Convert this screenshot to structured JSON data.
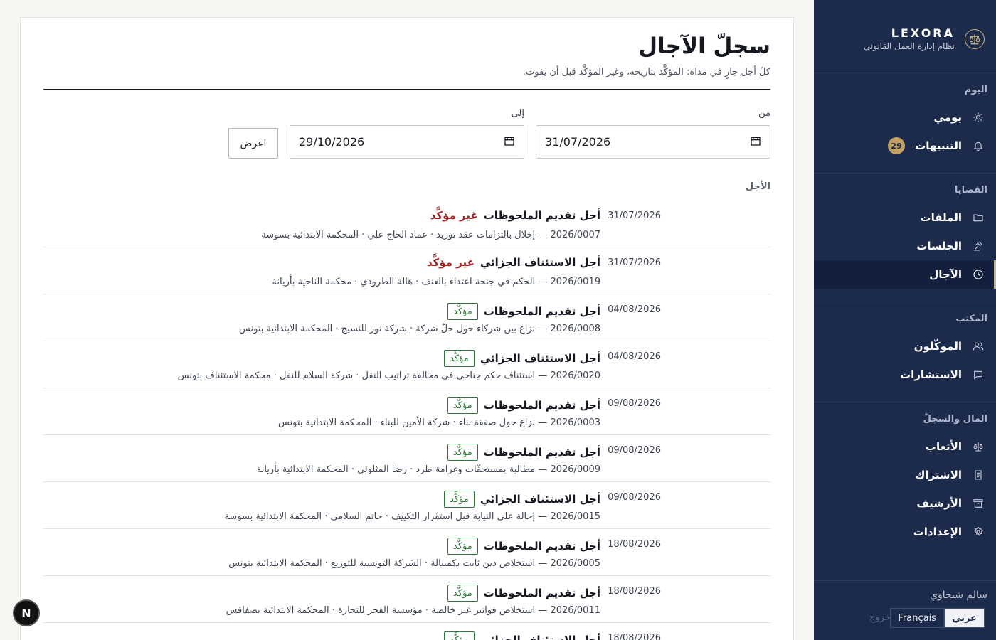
{
  "brand": {
    "name": "LEXORA",
    "subtitle": "نظام إدارة العمل القانوني"
  },
  "nav": [
    {
      "heading": "اليوم",
      "items": [
        {
          "label": "يومي",
          "icon": "sun-icon"
        },
        {
          "label": "التنبيهات",
          "icon": "bell-icon",
          "badge": "29"
        }
      ]
    },
    {
      "heading": "القضايا",
      "items": [
        {
          "label": "الملفات",
          "icon": "folder-icon"
        },
        {
          "label": "الجلسات",
          "icon": "gavel-icon"
        },
        {
          "label": "الآجال",
          "icon": "clock-icon",
          "active": true
        }
      ]
    },
    {
      "heading": "المكتب",
      "items": [
        {
          "label": "الموكّلون",
          "icon": "users-icon"
        },
        {
          "label": "الاستشارات",
          "icon": "chat-icon"
        }
      ]
    },
    {
      "heading": "المال والسجلّ",
      "items": [
        {
          "label": "الأتعاب",
          "icon": "scale-icon"
        },
        {
          "label": "الاشتراك",
          "icon": "receipt-icon"
        },
        {
          "label": "الأرشيف",
          "icon": "archive-icon"
        },
        {
          "label": "الإعدادات",
          "icon": "gear-icon"
        }
      ]
    }
  ],
  "user": {
    "name": "سالم شيحاوي",
    "lang_ar": "عربي",
    "lang_fr": "Français",
    "logout": "خروج"
  },
  "page": {
    "title": "سجلّ الآجال",
    "subtitle": "كلّ أجل جارٍ في مداه: المؤكَّد بتاريخه، وغير المؤكَّد قبل أن يفوت.",
    "from_label": "من",
    "to_label": "إلى",
    "from_value": "31/07/2026",
    "to_value": "29/10/2026",
    "show_button": "اعرض",
    "column_header": "الأجل"
  },
  "status_labels": {
    "confirmed": "مؤكَّد",
    "unconfirmed": "غير مؤكَّد"
  },
  "deadlines": [
    {
      "date": "31/07/2026",
      "title": "أجل تقديم الملحوظات",
      "status": "unconfirmed",
      "meta": "2026/0007 — إخلال بالتزامات عقد توريد · عماد الحاج علي · المحكمة الابتدائية بسوسة"
    },
    {
      "date": "31/07/2026",
      "title": "أجل الاستئناف الجزائي",
      "status": "unconfirmed",
      "meta": "2026/0019 — الحكم في جنحة اعتداء بالعنف · هالة الطرودي · محكمة الناحية بأريانة"
    },
    {
      "date": "04/08/2026",
      "title": "أجل تقديم الملحوظات",
      "status": "confirmed",
      "meta": "2026/0008 — نزاع بين شركاء حول حلّ شركة · شركة نور للنسيج · المحكمة الابتدائية بتونس"
    },
    {
      "date": "04/08/2026",
      "title": "أجل الاستئناف الجزائي",
      "status": "confirmed",
      "meta": "2026/0020 — استئناف حكم جناحي في مخالفة تراتيب النقل · شركة السلام للنقل · محكمة الاستئناف بتونس"
    },
    {
      "date": "09/08/2026",
      "title": "أجل تقديم الملحوظات",
      "status": "confirmed",
      "meta": "2026/0003 — نزاع حول صفقة بناء · شركة الأمين للبناء · المحكمة الابتدائية بتونس"
    },
    {
      "date": "09/08/2026",
      "title": "أجل تقديم الملحوظات",
      "status": "confirmed",
      "meta": "2026/0009 — مطالبة بمستحقّات وغرامة طرد · رضا المثلوثي · المحكمة الابتدائية بأريانة"
    },
    {
      "date": "09/08/2026",
      "title": "أجل الاستئناف الجزائي",
      "status": "confirmed",
      "meta": "2026/0015 — إحالة على النيابة قبل استقرار التكييف · حاتم السلامي · المحكمة الابتدائية بسوسة"
    },
    {
      "date": "18/08/2026",
      "title": "أجل تقديم الملحوظات",
      "status": "confirmed",
      "meta": "2026/0005 — استخلاص دين ثابت بكمبيالة · الشركة التونسية للتوزيع · المحكمة الابتدائية بتونس"
    },
    {
      "date": "18/08/2026",
      "title": "أجل تقديم الملحوظات",
      "status": "confirmed",
      "meta": "2026/0011 — استخلاص فواتير غير خالصة · مؤسسة الفجر للتجارة · المحكمة الابتدائية بصفاقس"
    },
    {
      "date": "18/08/2026",
      "title": "أجل الاستئناف الجزائي",
      "status": "confirmed",
      "meta": ""
    }
  ],
  "fab_label": "N"
}
